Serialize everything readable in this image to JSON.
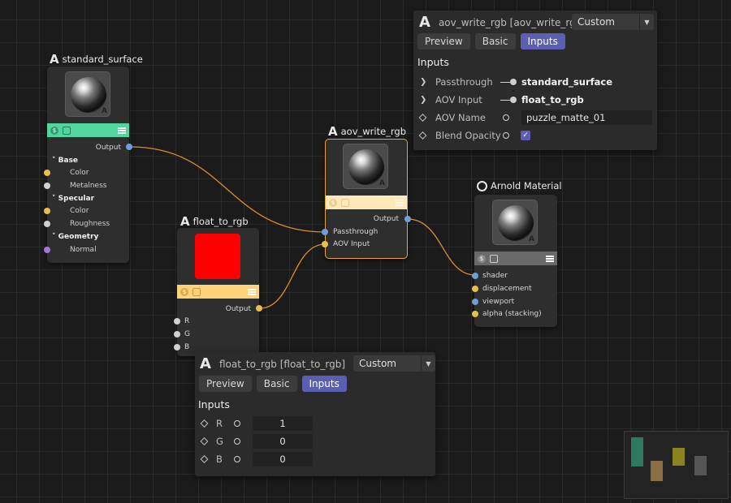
{
  "nodes": {
    "standard_surface": {
      "title": "standard_surface",
      "output": "Output",
      "sections": [
        {
          "label": "Base",
          "ports": [
            "Color",
            "Metalness"
          ]
        },
        {
          "label": "Specular",
          "ports": [
            "Color",
            "Roughness"
          ]
        },
        {
          "label": "Geometry",
          "ports": [
            "Normal"
          ]
        }
      ],
      "bar_color": "#52d6a0"
    },
    "float_to_rgb": {
      "title": "float_to_rgb",
      "output": "Output",
      "ports": [
        "R",
        "G",
        "B"
      ],
      "swatch_color": "#ff0000",
      "bar_color": "#ffd27a"
    },
    "aov_write_rgb": {
      "title": "aov_write_rgb",
      "output": "Output",
      "ports": [
        "Passthrough",
        "AOV Input"
      ],
      "bar_color": "#ffe9b8"
    },
    "arnold_material": {
      "title": "Arnold Material",
      "ports": [
        "shader",
        "displacement",
        "viewport",
        "alpha (stacking)"
      ],
      "bar_color": "#6a6a6a"
    }
  },
  "panel_aov": {
    "title": "aov_write_rgb [aov_write_rgb]",
    "dropdown": "Custom",
    "tabs": [
      "Preview",
      "Basic",
      "Inputs"
    ],
    "active_tab": "Inputs",
    "section": "Inputs",
    "rows": [
      {
        "label": "Passthrough",
        "value": "standard_surface"
      },
      {
        "label": "AOV Input",
        "value": "float_to_rgb"
      },
      {
        "label": "AOV Name",
        "value": "puzzle_matte_01"
      },
      {
        "label": "Blend Opacity",
        "value": "✓"
      }
    ]
  },
  "panel_float": {
    "title": "float_to_rgb [float_to_rgb]",
    "dropdown": "Custom",
    "tabs": [
      "Preview",
      "Basic",
      "Inputs"
    ],
    "active_tab": "Inputs",
    "section": "Inputs",
    "rows": [
      {
        "label": "R",
        "value": "1"
      },
      {
        "label": "G",
        "value": "0"
      },
      {
        "label": "B",
        "value": "0"
      }
    ]
  },
  "colors": {
    "wire": "#d98f2b",
    "accent": "#5a5fb1",
    "selection": "#e8a640"
  },
  "icons": [
    "arnold-logo-icon",
    "sphere-preview-icon",
    "dollar-icon",
    "image-icon",
    "menu-icon",
    "chevron-right-icon",
    "diamond-keyframe-icon",
    "chevron-down-icon",
    "checkbox-icon"
  ]
}
